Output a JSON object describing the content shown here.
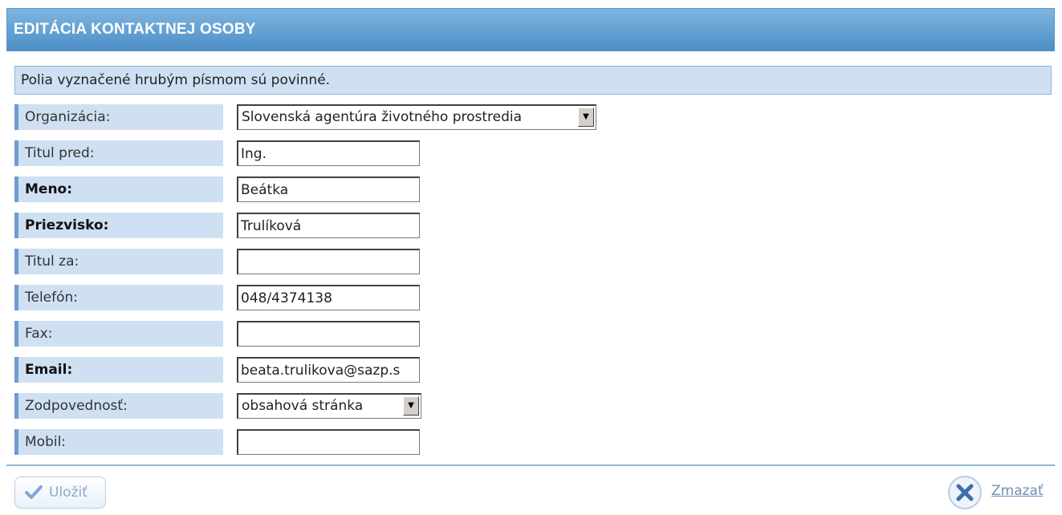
{
  "header": {
    "title": "EDITÁCIA KONTAKTNEJ OSOBY"
  },
  "notice": "Polia vyznačené hrubým písmom sú povinné.",
  "form": {
    "organizacia": {
      "label": "Organizácia:",
      "value": "Slovenská agentúra životného prostredia"
    },
    "titul_pred": {
      "label": "Titul pred:",
      "value": "Ing."
    },
    "meno": {
      "label": "Meno:",
      "value": "Beátka"
    },
    "priezvisko": {
      "label": "Priezvisko:",
      "value": "Trulíková"
    },
    "titul_za": {
      "label": "Titul za:",
      "value": ""
    },
    "telefon": {
      "label": "Telefón:",
      "value": "048/4374138"
    },
    "fax": {
      "label": "Fax:",
      "value": ""
    },
    "email": {
      "label": "Email:",
      "value": "beata.trulikova@sazp.s"
    },
    "zodpovednost": {
      "label": "Zodpovednosť:",
      "value": "obsahová stránka"
    },
    "mobil": {
      "label": "Mobil:",
      "value": ""
    }
  },
  "footer": {
    "save_label": "Uložiť",
    "delete_label": "Zmazať"
  },
  "colors": {
    "header_gradient_top": "#7fb5df",
    "header_gradient_bottom": "#4d8fc8",
    "label_background": "#cfe0f3",
    "label_accent": "#6f9ccf"
  },
  "icons": {
    "select_arrow": "triangle-down-icon",
    "save": "checkmark-icon",
    "delete": "x-circle-icon"
  }
}
